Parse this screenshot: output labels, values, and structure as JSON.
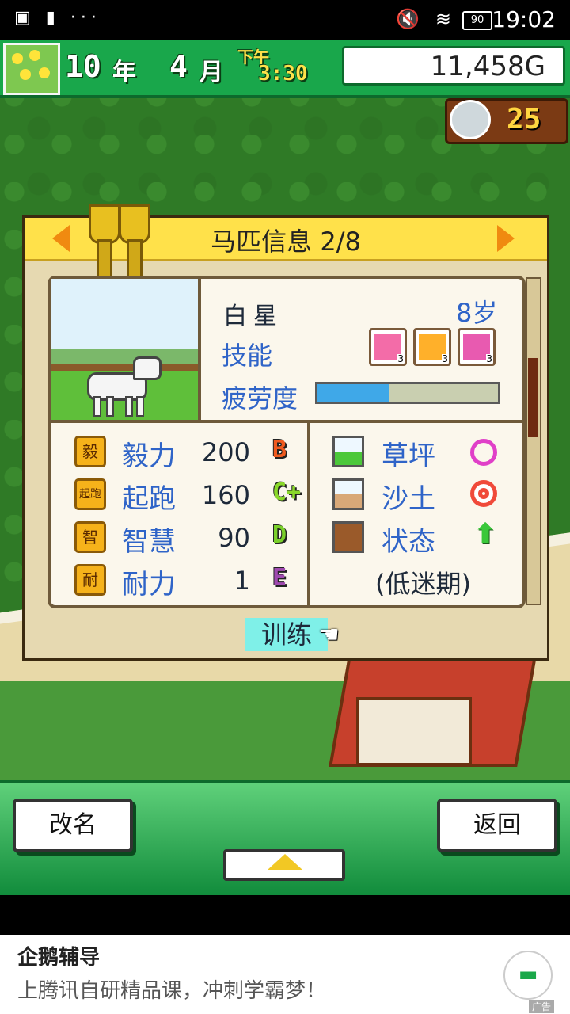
{
  "status_bar": {
    "time": "19:02",
    "battery": "90"
  },
  "hud": {
    "year_num": "10",
    "year_unit": "年",
    "month_num": "4",
    "month_unit": "月",
    "ampm": "下午",
    "clock": "3:30",
    "money": "11,458G",
    "medals": "25"
  },
  "panel": {
    "title": "马匹信息 2/8",
    "horse": {
      "name": "白星",
      "age": "8岁"
    },
    "skills_label": "技能",
    "skills": [
      {
        "level": "3",
        "icon": "horse-skill-icon"
      },
      {
        "level": "3",
        "icon": "start-skill-icon"
      },
      {
        "level": "3",
        "icon": "jockey-skill-icon"
      }
    ],
    "fatigue_label": "疲劳度",
    "fatigue_level": 0.4,
    "stats": [
      {
        "icon_text": "毅",
        "label": "毅力",
        "value": "200",
        "grade": "B",
        "color": "#f05a1e"
      },
      {
        "icon_text": "起跑",
        "label": "起跑",
        "value": "160",
        "grade": "C+",
        "color": "#8ad82a"
      },
      {
        "icon_text": "智",
        "label": "智慧",
        "value": "90",
        "grade": "D",
        "color": "#7ad02a"
      },
      {
        "icon_text": "耐",
        "label": "耐力",
        "value": "1",
        "grade": "E",
        "color": "#a04ab0"
      }
    ],
    "terrain": [
      {
        "label": "草坪",
        "mark": "○"
      },
      {
        "label": "沙土",
        "mark": "◎"
      },
      {
        "label": "状态",
        "mark": "↑"
      }
    ],
    "condition_note": "(低迷期)",
    "train_label": "训练"
  },
  "buttons": {
    "rename": "改名",
    "back": "返回"
  },
  "ad": {
    "title": "企鹅辅导",
    "desc": "上腾讯自研精品课，冲刺学霸梦！",
    "tag": "广告"
  }
}
